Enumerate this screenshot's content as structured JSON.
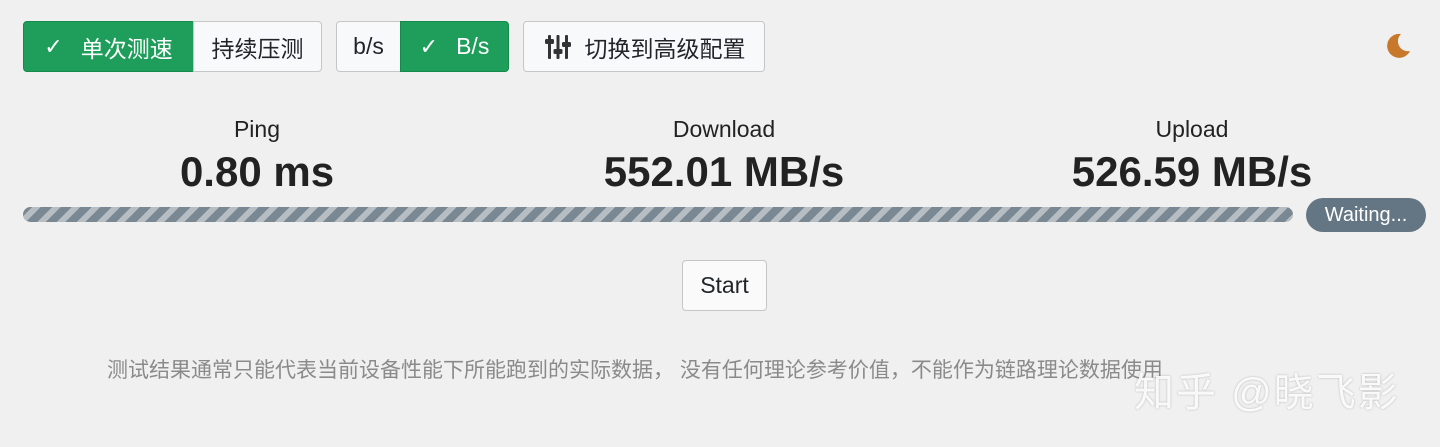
{
  "toolbar": {
    "mode_single_label": "单次测速",
    "mode_continuous_label": "持续压测",
    "unit_bits_label": "b/s",
    "unit_bytes_label": "B/s",
    "advanced_config_label": "切换到高级配置"
  },
  "stats": {
    "ping": {
      "label": "Ping",
      "value": "0.80 ms"
    },
    "download": {
      "label": "Download",
      "value": "552.01 MB/s"
    },
    "upload": {
      "label": "Upload",
      "value": "526.59 MB/s"
    }
  },
  "progress": {
    "status": "Waiting..."
  },
  "start_label": "Start",
  "disclaimer": "测试结果通常只能代表当前设备性能下所能跑到的实际数据， 没有任何理论参考价值，不能作为链路理论数据使用",
  "watermark": "知乎 @晓飞影",
  "colors": {
    "active_green": "#1e9e5a",
    "badge_gray": "#647583",
    "moon_orange": "#c8782a"
  },
  "icons": {
    "check": "check-icon",
    "sliders": "sliders-icon",
    "theme": "moon-icon"
  }
}
